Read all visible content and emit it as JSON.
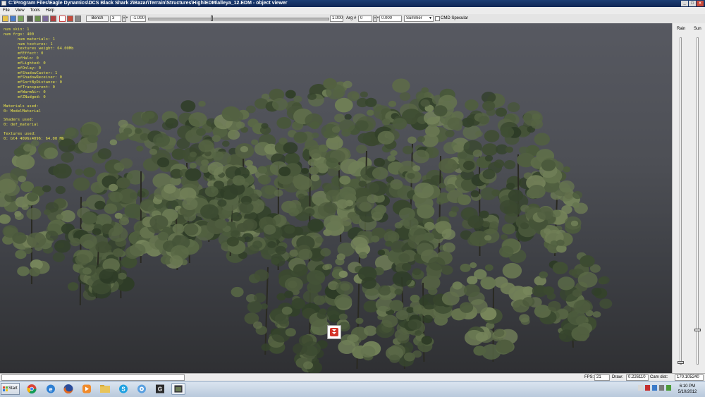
{
  "window": {
    "title": "C:\\Program Files\\Eagle Dynamics\\DCS Black Shark 2\\Bazar\\Terrain\\Structures\\High\\EDM\\alleya_12.EDM - object viewer",
    "controls": [
      "_",
      "□",
      "×"
    ]
  },
  "menu": [
    "File",
    "View",
    "Tools",
    "Help"
  ],
  "toolbar": {
    "bench_label": "Bench",
    "bench_value": "3",
    "min_value": "-1.000",
    "max_value": "1.000",
    "arg_label": "Arg #",
    "arg_value": "0",
    "arg_value2": "0.000",
    "season": "Summer",
    "specular_label": "CMD Specular",
    "slider_level": 0.35
  },
  "stats": {
    "lines": [
      {
        "text": "num skin: 1",
        "indent": false
      },
      {
        "text": "num frgs: 400",
        "indent": false
      },
      {
        "text": "num materials: 1",
        "indent": true
      },
      {
        "text": "num textures: 1",
        "indent": true
      },
      {
        "text": "textures weight: 64.00Mb",
        "indent": true
      },
      {
        "text": "mfEffect: 0",
        "indent": true
      },
      {
        "text": "mfHalo: 0",
        "indent": true
      },
      {
        "text": "mfLighted: 0",
        "indent": true
      },
      {
        "text": "mfOnlay: 0",
        "indent": true
      },
      {
        "text": "mfShadowCaster: 1",
        "indent": true
      },
      {
        "text": "mfShadowReceiver: 0",
        "indent": true
      },
      {
        "text": "mfSortByDistance: 0",
        "indent": true
      },
      {
        "text": "mfTransparent: 0",
        "indent": true
      },
      {
        "text": "mfWarmAir: 0",
        "indent": true
      },
      {
        "text": "mfZNudged: 0",
        "indent": true
      },
      {
        "text": "",
        "indent": false
      },
      {
        "text": "Materials used:",
        "indent": false
      },
      {
        "text": "0: ModelMaterial",
        "indent": false
      },
      {
        "text": "",
        "indent": false
      },
      {
        "text": "Shaders used:",
        "indent": false
      },
      {
        "text": "0: def_material",
        "indent": false
      },
      {
        "text": "",
        "indent": false
      },
      {
        "text": "Textures used:",
        "indent": false
      },
      {
        "text": "0: bt4 4096x4096: 64.00 Mb",
        "indent": false
      }
    ]
  },
  "right_panel": {
    "rain_label": "Rain",
    "sun_label": "Sun",
    "rain_level": 0.0,
    "sun_level": 0.1
  },
  "status": {
    "fps_label": "FPS:",
    "fps_value": "21",
    "draw_label": "Draw:",
    "draw_value": "0.226110",
    "camdist_label": "Cam dist:",
    "camdist_value": "170.105240"
  },
  "taskbar": {
    "start_label": "Start",
    "apps": [
      "chrome-icon",
      "internet-explorer-icon",
      "firefox-icon",
      "media-player-icon",
      "folder-icon",
      "skype-icon",
      "itunes-icon",
      "dcs-app-icon",
      "object-viewer-icon"
    ],
    "time": "6:10 PM",
    "date": "5/10/2012"
  },
  "colors": {
    "stats_text": "#e9e34b",
    "titlebar": "#1c3d73",
    "foliage_dark": "#2c3a25",
    "foliage_light": "#8c9b6b"
  }
}
